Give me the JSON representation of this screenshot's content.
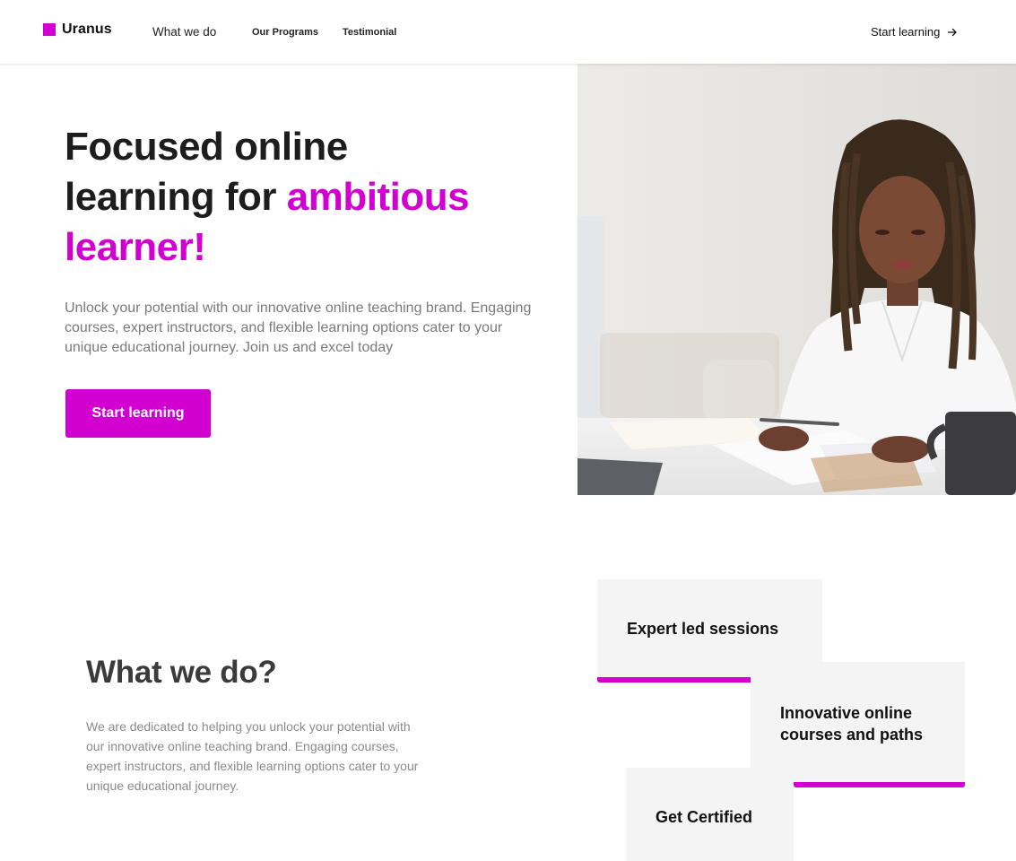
{
  "brand": {
    "name": "Uranus",
    "color": "#d100d1"
  },
  "nav": {
    "items": [
      {
        "label": "What we do"
      },
      {
        "label": "Our Programs"
      },
      {
        "label": "Testimonial"
      }
    ],
    "cta_label": "Start learning",
    "cta_icon": "arrow-right-icon"
  },
  "hero": {
    "title_line1": "Focused online",
    "title_line2_plain": "learning for ",
    "title_line2_accent": "ambitious",
    "title_line3_accent": "learner!",
    "description": "Unlock your potential with our innovative online teaching brand. Engaging courses, expert instructors, and flexible learning options cater to your unique educational journey. Join us and excel today",
    "cta_label": "Start learning"
  },
  "what_we_do": {
    "title": "What we do?",
    "description": "We are dedicated to helping you unlock your potential with our innovative online teaching brand. Engaging courses, expert instructors, and flexible learning options cater to your unique educational journey.",
    "cards": [
      {
        "label": "Expert led sessions"
      },
      {
        "label": "Innovative online courses and paths"
      },
      {
        "label": "Get Certified"
      }
    ]
  }
}
